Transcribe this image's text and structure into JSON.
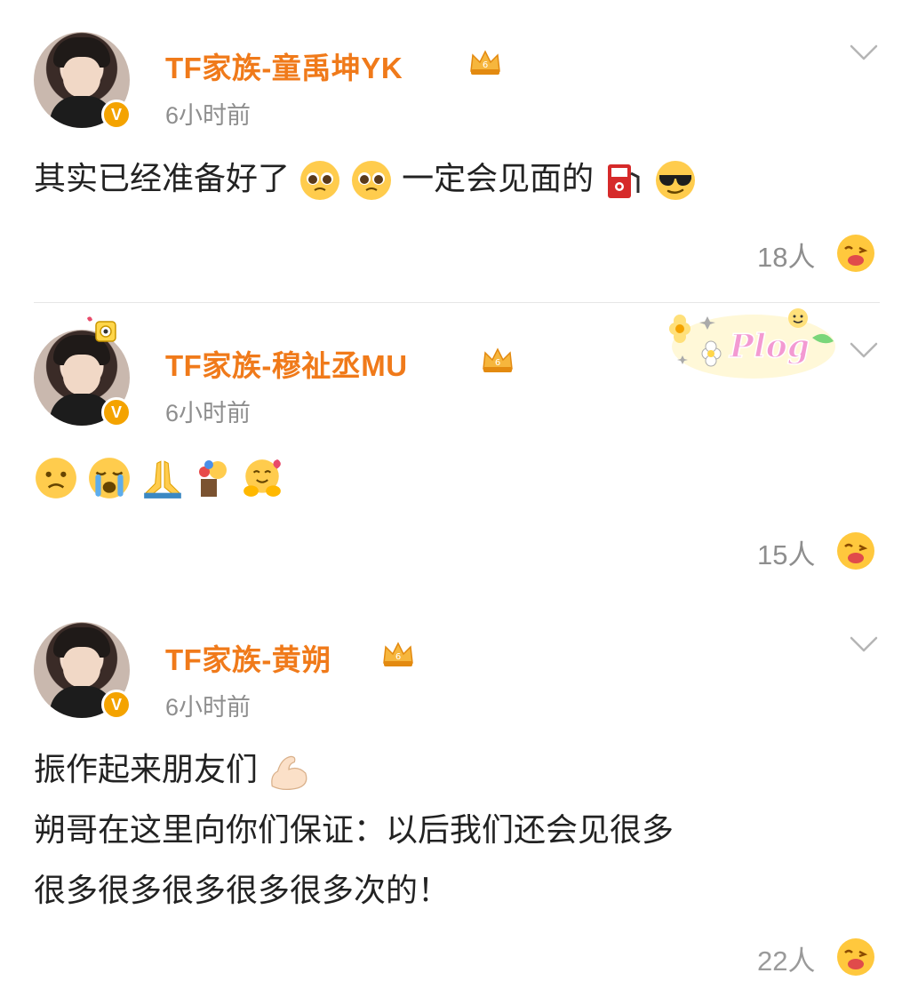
{
  "posts": [
    {
      "username": "TF家族-童禹坤YK",
      "time": "6小时前",
      "content_lines": [
        "其实已经准备好了",
        "一定会见面的"
      ],
      "likes": "18人"
    },
    {
      "username": "TF家族-穆祉丞MU",
      "time": "6小时前",
      "likes": "15人"
    },
    {
      "username": "TF家族-黄朔",
      "time": "6小时前",
      "content_lines": [
        "振作起来朋友们",
        "朔哥在这里向你们保证：以后我们还会见很多",
        "很多很多很多很多很多次的！"
      ],
      "likes": "22人"
    }
  ],
  "badge": {
    "vip_letter": "V",
    "crown_level": "6"
  },
  "decoration": {
    "sticker_text": "Plog"
  },
  "colors": {
    "username": "#f07a1a",
    "muted": "#8e8e8e",
    "vip": "#f4a300"
  }
}
